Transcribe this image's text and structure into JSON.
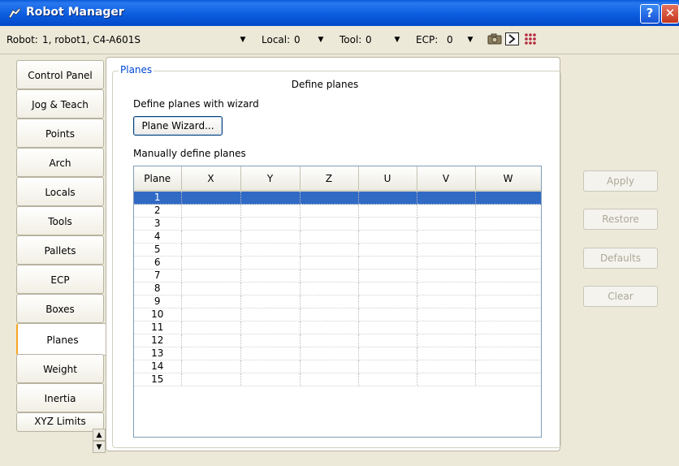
{
  "window": {
    "title": "Robot Manager",
    "help": "?",
    "close": "✕"
  },
  "toolbar": {
    "robot_label": "Robot:",
    "robot_value": "1, robot1, C4-A601S",
    "local_label": "Local:",
    "local_value": "0",
    "tool_label": "Tool:",
    "tool_value": "0",
    "ecp_label": "ECP:",
    "ecp_value": "0"
  },
  "tabs": [
    {
      "label": "Control Panel"
    },
    {
      "label": "Jog & Teach"
    },
    {
      "label": "Points"
    },
    {
      "label": "Arch"
    },
    {
      "label": "Locals"
    },
    {
      "label": "Tools"
    },
    {
      "label": "Pallets"
    },
    {
      "label": "ECP"
    },
    {
      "label": "Boxes"
    },
    {
      "label": "Planes"
    },
    {
      "label": "Weight"
    },
    {
      "label": "Inertia"
    },
    {
      "label": "XYZ Limits"
    }
  ],
  "active_tab": "Planes",
  "planes": {
    "group_label": "Planes",
    "header": "Define planes",
    "wizard_label": "Define planes with wizard",
    "wizard_button": "Plane Wizard...",
    "manual_label": "Manually define planes",
    "columns": [
      "Plane",
      "X",
      "Y",
      "Z",
      "U",
      "V",
      "W"
    ],
    "rows": [
      "1",
      "2",
      "3",
      "4",
      "5",
      "6",
      "7",
      "8",
      "9",
      "10",
      "11",
      "12",
      "13",
      "14",
      "15"
    ],
    "selected_row": "1"
  },
  "buttons": {
    "apply": "Apply",
    "restore": "Restore",
    "defaults": "Defaults",
    "clear": "Clear"
  },
  "colors": {
    "title_bar": "#0b5ee0",
    "selection": "#316ac5",
    "group_label": "#0046d5"
  }
}
